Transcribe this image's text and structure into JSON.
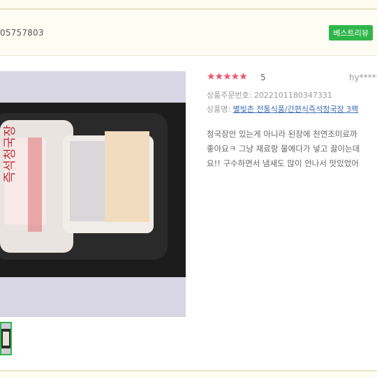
{
  "review": {
    "number_partial": "05757803",
    "best_badge": "베스트리뷰",
    "rating_score": "5",
    "rating_stars": "★★★★★",
    "user_masked": "hy*****",
    "order_label": "상품주문번호:",
    "order_number": "2022101180347331",
    "product_label": "상품명:",
    "product_name": "별빛촌 전통식품/간편식즉석청국장 3팩",
    "content_lines": [
      "청국장만 있는게 아니라 된장에 천연조미료까",
      "좋아요ㅋ 그냥 재료랑 물에다가 넣고 끓이는데",
      "요!! 구수하면서 냄새도 많이 안나서 맛있었어"
    ],
    "photo_label": "즉석청국장",
    "colors": {
      "accent": "#2fb64a",
      "star": "#f0506e",
      "link": "#3f6fb5"
    }
  }
}
